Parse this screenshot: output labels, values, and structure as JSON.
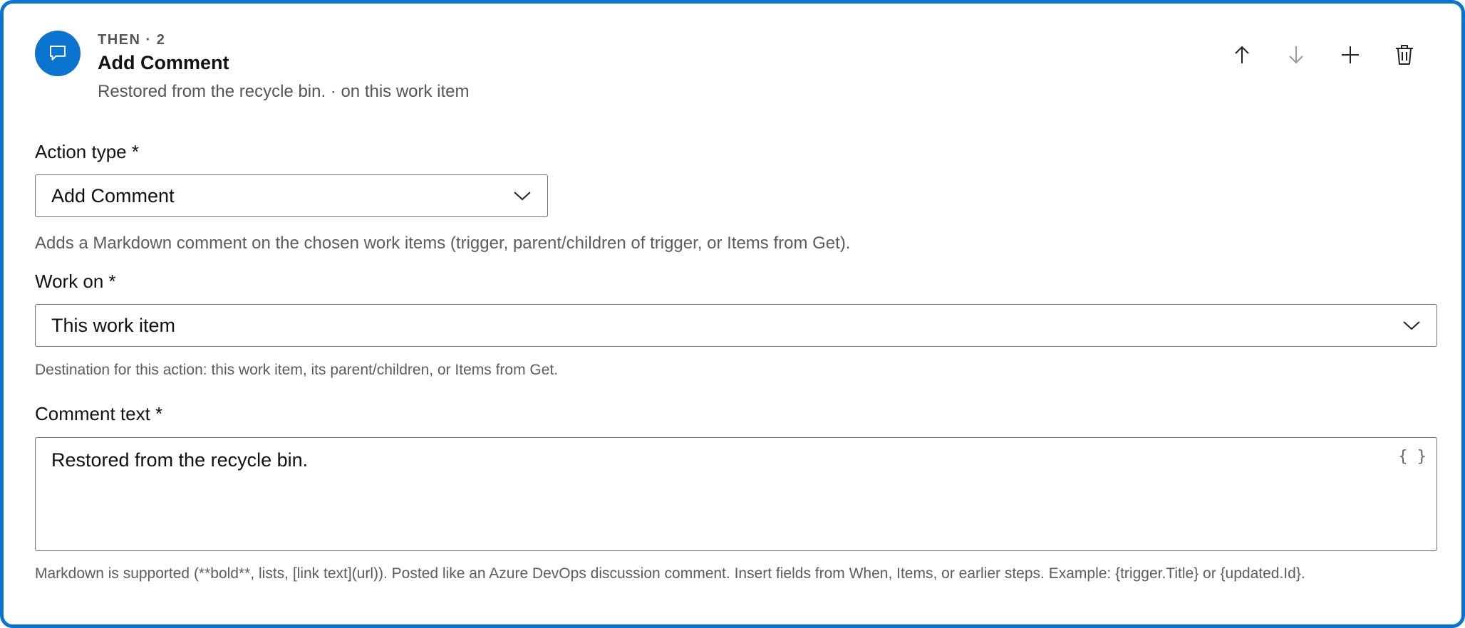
{
  "header": {
    "kicker": "THEN · 2",
    "title": "Add Comment",
    "summary": "Restored from the recycle bin. · on this work item",
    "icon": "comment-icon",
    "accent_color": "#0b74d0"
  },
  "toolbar": {
    "move_up_icon": "arrow-up-icon",
    "move_down_icon": "arrow-down-icon",
    "add_icon": "plus-icon",
    "delete_icon": "trash-icon"
  },
  "action_type": {
    "label": "Action type *",
    "value": "Add Comment",
    "help": "Adds a Markdown comment on the chosen work items (trigger, parent/children of trigger, or Items from Get)."
  },
  "work_on": {
    "label": "Work on *",
    "value": "This work item",
    "help": "Destination for this action: this work item, its parent/children, or Items from Get."
  },
  "comment": {
    "label": "Comment text *",
    "value": "Restored from the recycle bin.",
    "insert_fields_glyph": "{ }",
    "help": "Markdown is supported (**bold**, lists, [link text](url)). Posted like an Azure DevOps discussion comment. Insert fields from When, Items, or earlier steps. Example: {trigger.Title} or {updated.Id}."
  }
}
